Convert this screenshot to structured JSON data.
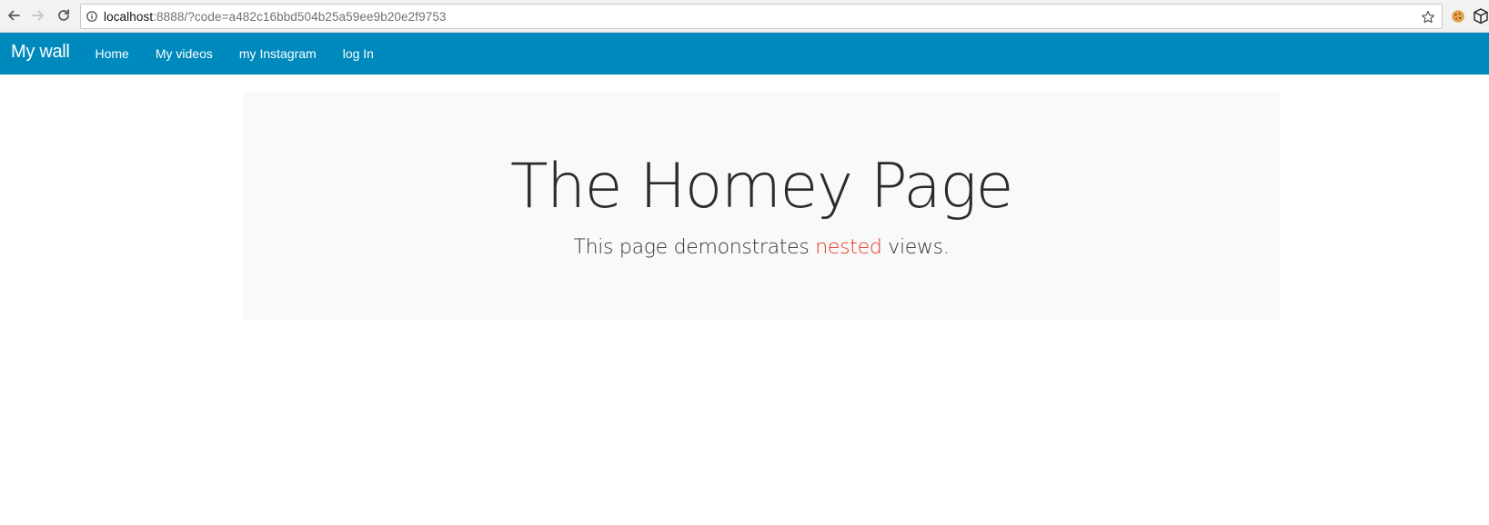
{
  "browser": {
    "url_host": "localhost",
    "url_rest": ":8888/?code=a482c16bbd504b25a59ee9b20e2f9753",
    "icons": {
      "back": "back-arrow-icon",
      "forward": "forward-arrow-icon",
      "reload": "reload-icon",
      "info": "info-icon",
      "bookmark": "star-icon",
      "extension_1": "cookie-icon",
      "extension_2": "box-icon"
    }
  },
  "navbar": {
    "brand": "My wall",
    "links": [
      {
        "label": "Home"
      },
      {
        "label": "My videos"
      },
      {
        "label": "my Instagram"
      },
      {
        "label": "log In"
      }
    ],
    "background_color": "#0089bd"
  },
  "jumbotron": {
    "title": "The Homey Page",
    "subtitle_before": "This page demonstrates ",
    "subtitle_accent": "nested",
    "subtitle_after": " views.",
    "accent_color": "#e8352a",
    "background_color": "#f9f9f9"
  }
}
